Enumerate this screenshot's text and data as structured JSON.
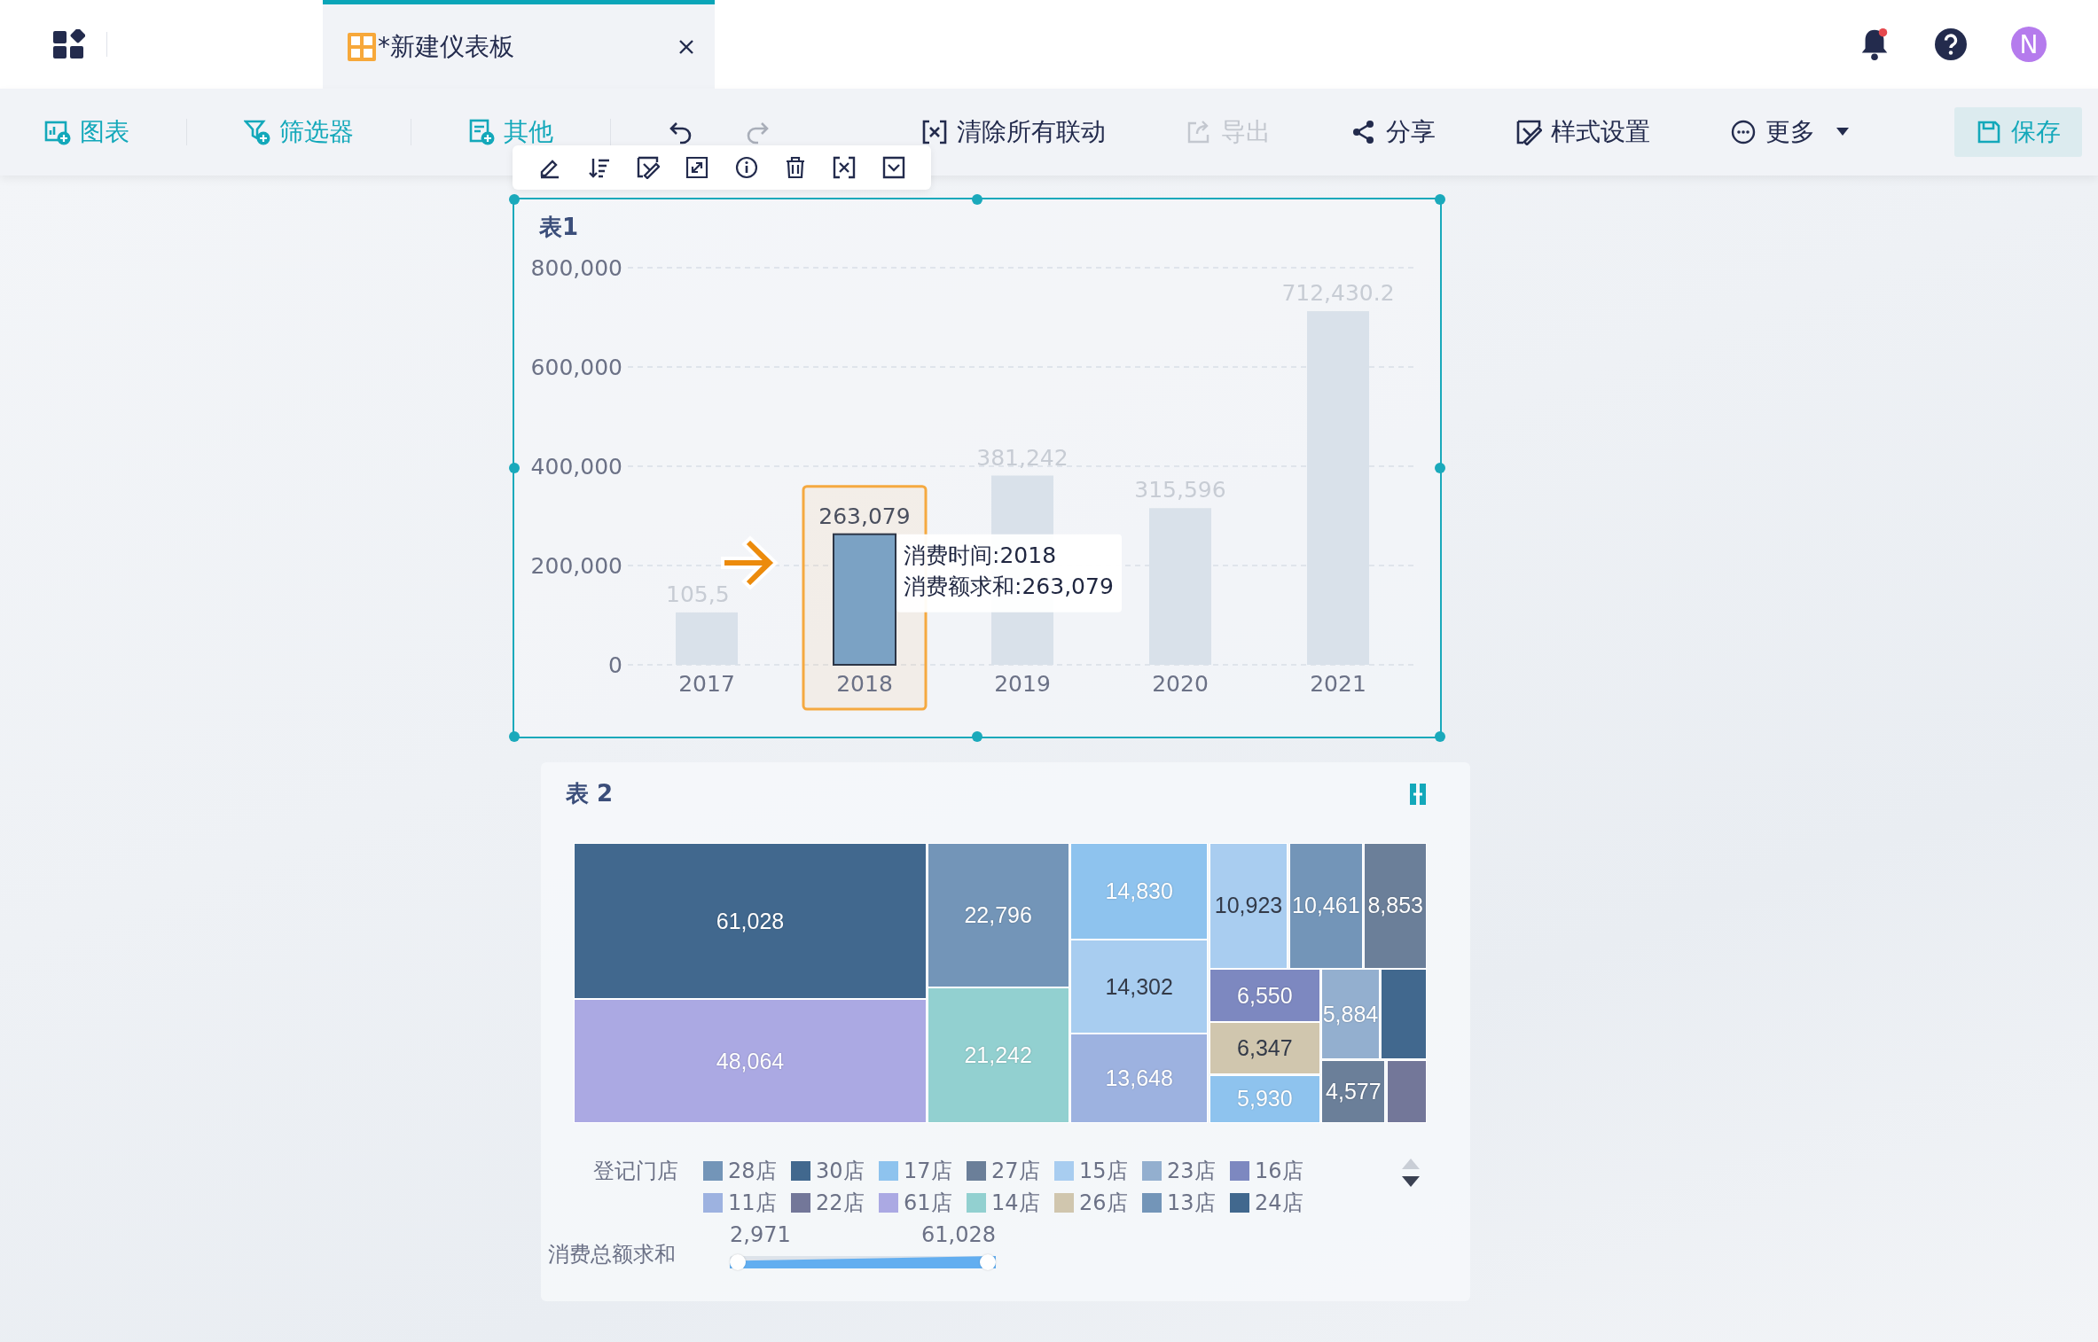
{
  "header": {
    "tab": {
      "title": "*新建仪表板",
      "selected": true
    },
    "notification": true,
    "avatar": "N"
  },
  "toolbar": {
    "create": [
      {
        "label": "图表",
        "kind": "chart"
      },
      {
        "label": "筛选器",
        "kind": "filter"
      },
      {
        "label": "其他",
        "kind": "other"
      }
    ],
    "history": [
      {
        "kind": "undo",
        "disabled": false
      },
      {
        "kind": "redo",
        "disabled": true
      }
    ],
    "actions": [
      {
        "label": "清除所有联动",
        "kind": "unlink",
        "disabled": false,
        "dropdown": false
      },
      {
        "label": "导出",
        "kind": "export",
        "disabled": true,
        "dropdown": false
      },
      {
        "label": "分享",
        "kind": "share",
        "disabled": false,
        "dropdown": false
      },
      {
        "label": "样式设置",
        "kind": "style",
        "disabled": false,
        "dropdown": false
      },
      {
        "label": "更多",
        "kind": "more",
        "disabled": false,
        "dropdown": true
      }
    ],
    "save": {
      "label": "保存"
    }
  },
  "chart1": {
    "title": "表1",
    "selected": true,
    "chart_data": {
      "type": "bar",
      "categories": [
        "2017",
        "2018",
        "2019",
        "2020",
        "2021"
      ],
      "values": [
        105500,
        263079,
        381242,
        315596,
        712430.2
      ],
      "ylim": [
        0,
        800000
      ],
      "yticks": [
        {
          "value": 0,
          "label": "0"
        },
        {
          "value": 200000,
          "label": "200,000"
        },
        {
          "value": 400000,
          "label": "400,000"
        },
        {
          "value": 600000,
          "label": "600,000"
        },
        {
          "value": 800000,
          "label": "800,000"
        }
      ],
      "grid": true,
      "value_labels": [
        null,
        "263,079",
        "381,242",
        "315,596",
        "712,430.2"
      ],
      "annotations": [
        {
          "text": "105,5",
          "x": "2017",
          "y": 105500
        }
      ]
    },
    "bars": [
      {
        "selected": false
      },
      {
        "selected": true
      },
      {
        "selected": false
      },
      {
        "selected": false
      },
      {
        "selected": false
      }
    ],
    "tooltip": {
      "lines": [
        "消费时间:2018",
        "消费额求和:263,079"
      ]
    }
  },
  "chart2": {
    "title": "表 2",
    "cells": [
      {
        "value": "61,028",
        "color": "#41688e"
      },
      {
        "value": "48,064",
        "color": "#aba9e3"
      },
      {
        "value": "22,796",
        "color": "#7395b8"
      },
      {
        "value": "21,242",
        "color": "#92d0d0"
      },
      {
        "value": "14,830",
        "color": "#8ec3ee"
      },
      {
        "value": "14,302",
        "color": "#a8cdf0"
      },
      {
        "value": "13,648",
        "color": "#9db2e0"
      },
      {
        "value": "10,923",
        "color": "#a9cdf0"
      },
      {
        "value": "10,461",
        "color": "#7395b8"
      },
      {
        "value": "8,853",
        "color": "#6b7f99"
      },
      {
        "value": "6,550",
        "color": "#7d88c0"
      },
      {
        "value": "6,347",
        "color": "#d0c6ae"
      },
      {
        "value": "5,930",
        "color": "#8ec3ee"
      },
      {
        "value": "5,884",
        "color": "#93afcf"
      },
      {
        "color": "#41688e"
      },
      {
        "value": "4,577",
        "color": "#6b7f99"
      },
      {
        "color": "#737799"
      }
    ],
    "legend": {
      "title": "登记门店",
      "items": [
        {
          "label": "28店",
          "color": "#7395b8"
        },
        {
          "label": "30店",
          "color": "#41688e"
        },
        {
          "label": "17店",
          "color": "#8ec3ee"
        },
        {
          "label": "27店",
          "color": "#6b7f99"
        },
        {
          "label": "15店",
          "color": "#a8cdf0"
        },
        {
          "label": "23店",
          "color": "#93afcf"
        },
        {
          "label": "16店",
          "color": "#7d88c0"
        },
        {
          "label": "11店",
          "color": "#9db2e0"
        },
        {
          "label": "22店",
          "color": "#737799"
        },
        {
          "label": "61店",
          "color": "#aba9e3"
        },
        {
          "label": "14店",
          "color": "#92d0d0"
        },
        {
          "label": "26店",
          "color": "#d0c6ae"
        },
        {
          "label": "13店",
          "color": "#7395b8"
        },
        {
          "label": "24店",
          "color": "#41688e"
        }
      ]
    },
    "range": {
      "title": "消费总额求和",
      "min": "2,971",
      "max": "61,028",
      "level": 1
    }
  }
}
